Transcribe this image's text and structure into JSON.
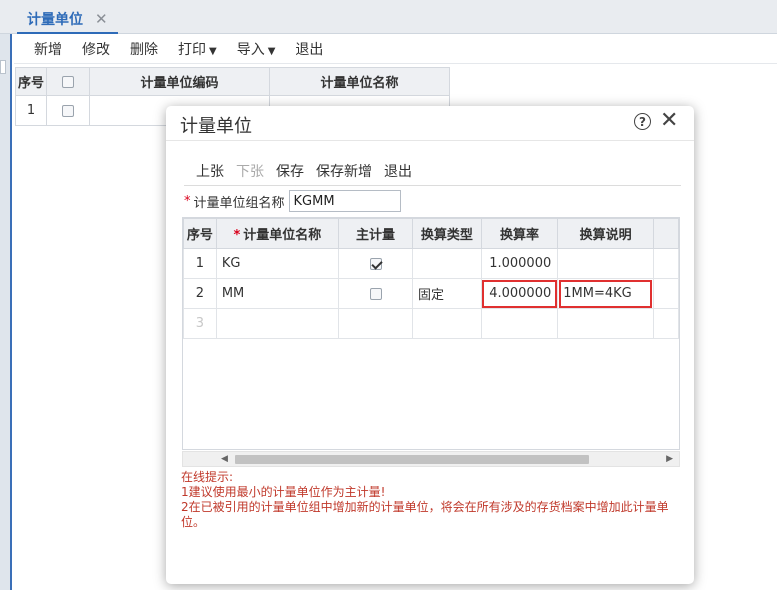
{
  "tab": {
    "title": "计量单位",
    "close": "✕"
  },
  "toolbar": {
    "add": "新增",
    "edit": "修改",
    "delete": "删除",
    "print": "打印",
    "import": "导入",
    "exit": "退出"
  },
  "bg_table": {
    "headers": [
      "序号",
      "",
      "计量单位编码",
      "计量单位名称"
    ],
    "rows": [
      {
        "index": "1",
        "code": "",
        "name": ""
      }
    ]
  },
  "modal": {
    "title": "计量单位",
    "help": "?",
    "close": "✕",
    "toolbar": {
      "prev": "上张",
      "next": "下张",
      "save": "保存",
      "save_new": "保存新增",
      "exit": "退出"
    },
    "group_label": "计量单位组名称",
    "group_value": "KGMM",
    "grid": {
      "headers": [
        "序号",
        "计量单位名称",
        "主计量",
        "换算类型",
        "换算率",
        "换算说明"
      ],
      "rows": [
        {
          "index": "1",
          "name": "KG",
          "main": true,
          "type": "",
          "rate": "1.000000",
          "desc": ""
        },
        {
          "index": "2",
          "name": "MM",
          "main": false,
          "type": "固定",
          "rate": "4.000000",
          "desc": "1MM=4KG"
        },
        {
          "index": "3",
          "name": "",
          "main": null,
          "type": "",
          "rate": "",
          "desc": ""
        }
      ]
    },
    "tips": {
      "title": "在线提示:",
      "line1": "1建议使用最小的计量单位作为主计量!",
      "line2": "2在已被引用的计量单位组中增加新的计量单位，将会在所有涉及的存货档案中增加此计量单位。"
    }
  },
  "colors": {
    "accent": "#2e6bb8",
    "highlight": "#e03030",
    "tips": "#c0392b"
  }
}
